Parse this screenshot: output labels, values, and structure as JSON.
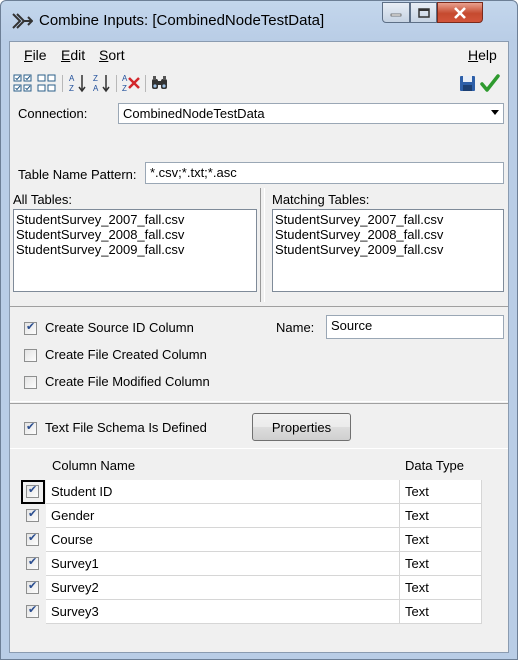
{
  "window": {
    "title": "Combine Inputs:  [CombinedNodeTestData]",
    "buttons": [
      "minimize",
      "maximize",
      "close"
    ]
  },
  "menu": {
    "file": "File",
    "edit": "Edit",
    "sort": "Sort",
    "help": "Help"
  },
  "toolbar": {
    "icons": [
      "select-all-icon",
      "deselect-all-icon",
      "sort-ascending-icon",
      "sort-descending-icon",
      "clear-sort-icon",
      "find-icon",
      "save-icon",
      "apply-check-icon"
    ]
  },
  "connection": {
    "label": "Connection:",
    "value": "CombinedNodeTestData"
  },
  "pattern": {
    "label": "Table Name Pattern:",
    "value": "*.csv;*.txt;*.asc"
  },
  "all_tables": {
    "label": "All Tables:",
    "items": [
      "StudentSurvey_2007_fall.csv",
      "StudentSurvey_2008_fall.csv",
      "StudentSurvey_2009_fall.csv"
    ]
  },
  "matching_tables": {
    "label": "Matching Tables:",
    "items": [
      "StudentSurvey_2007_fall.csv",
      "StudentSurvey_2008_fall.csv",
      "StudentSurvey_2009_fall.csv"
    ]
  },
  "options": {
    "source_id": {
      "label": "Create Source ID Column",
      "checked": true
    },
    "name_label": "Name:",
    "name_value": "Source",
    "file_created": {
      "label": "Create File Created Column",
      "checked": false
    },
    "file_modified": {
      "label": "Create File Modified Column",
      "checked": false
    }
  },
  "schema": {
    "label": "Text File Schema Is Defined",
    "checked": true,
    "button": "Properties"
  },
  "grid": {
    "headers": [
      "Column Name",
      "Data Type"
    ],
    "rows": [
      {
        "checked": true,
        "name": "Student ID",
        "type": "Text"
      },
      {
        "checked": true,
        "name": "Gender",
        "type": "Text"
      },
      {
        "checked": true,
        "name": "Course",
        "type": "Text"
      },
      {
        "checked": true,
        "name": "Survey1",
        "type": "Text"
      },
      {
        "checked": true,
        "name": "Survey2",
        "type": "Text"
      },
      {
        "checked": true,
        "name": "Survey3",
        "type": "Text"
      }
    ]
  },
  "colors": {
    "frame": "#b9cde6",
    "client": "#f0f0f0",
    "check": "#2a4d8f"
  }
}
